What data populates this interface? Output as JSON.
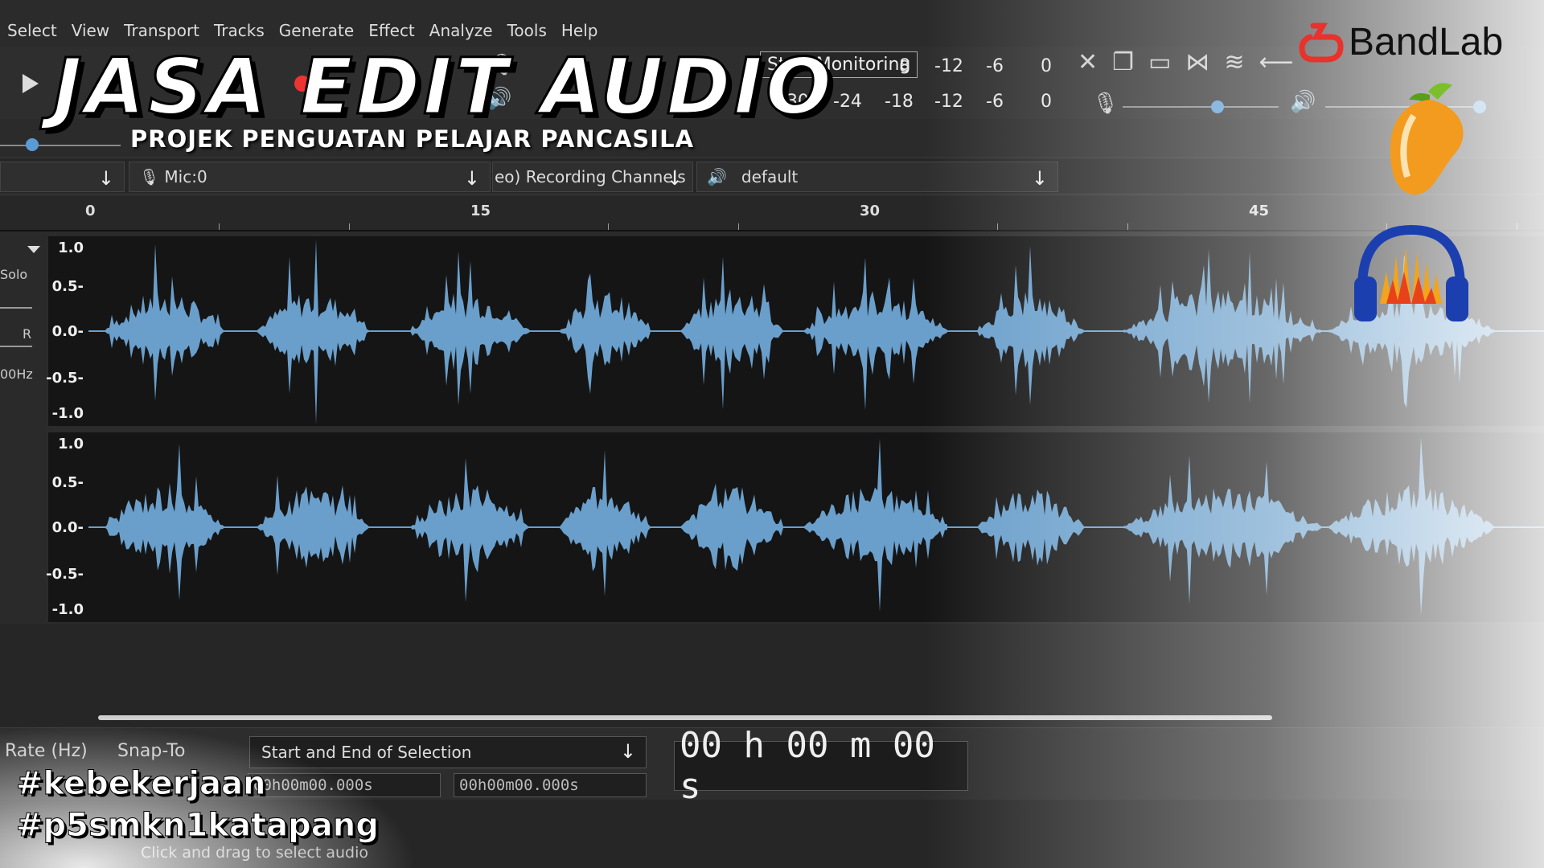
{
  "menu": [
    "Select",
    "View",
    "Transport",
    "Tracks",
    "Generate",
    "Effect",
    "Analyze",
    "Tools",
    "Help"
  ],
  "overlay": {
    "title": "JASA EDIT AUDIO",
    "subtitle": "PROJEK PENGUATAN PELAJAR PANCASILA",
    "hashtag1": "#kebekerjaan",
    "hashtag2": "#p5smkn1katapang",
    "brand": "BandLab"
  },
  "meters": {
    "monitor_button": "Start Monitoring",
    "row1": [
      "8",
      "-12",
      "-6",
      "0"
    ],
    "row2": [
      "-30",
      "-24",
      "-18",
      "-12",
      "-6",
      "0"
    ]
  },
  "device_bar": {
    "mic": "Mic:0",
    "channels": "eo) Recording Channels",
    "output": "default"
  },
  "ruler": {
    "labels": [
      "0",
      "15",
      "30",
      "45"
    ]
  },
  "track": {
    "solo": "Solo",
    "pan_right": "R",
    "rate_partial": "00Hz",
    "amp_labels": [
      "1.0",
      "0.5-",
      "0.0-",
      "-0.5-",
      "-1.0"
    ]
  },
  "selection_bar": {
    "rate_label": "Rate (Hz)",
    "snap_label": "Snap-To",
    "mode": "Start and End of Selection",
    "start": "00h00m00.000s",
    "end": "00h00m00.000s",
    "position": "00 h 00 m 00 s"
  },
  "status": "Click and drag to select audio",
  "colors": {
    "waveform": "#6a9fcb",
    "background": "#151515"
  }
}
